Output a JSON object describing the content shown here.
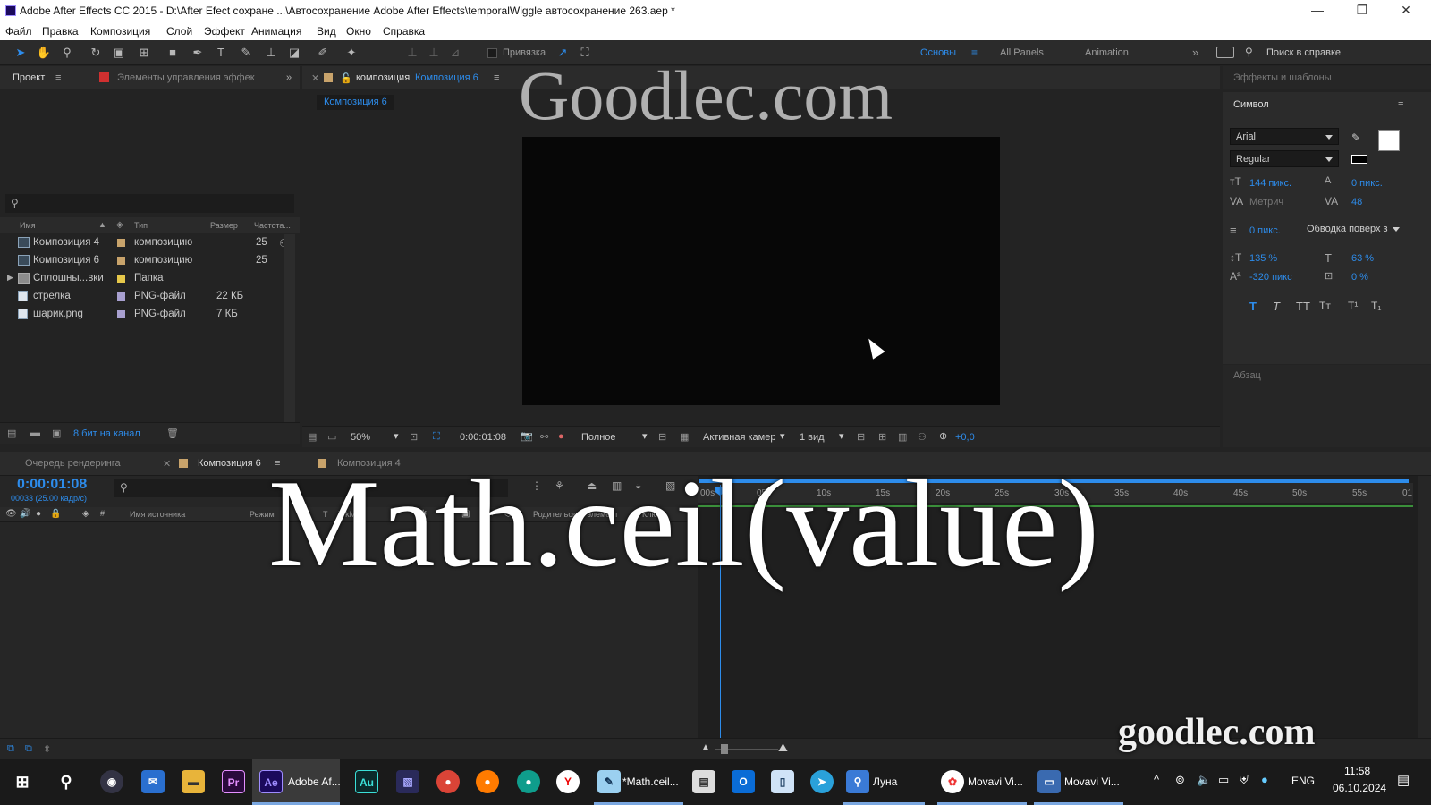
{
  "titlebar": {
    "title": "Adobe After Effects CC 2015 - D:\\After Efect сохране ...\\Автосохранение Adobe After Effects\\temporalWiggle автосохранение 263.aep *",
    "minimize": "—",
    "maximize": "❐",
    "close": "✕"
  },
  "menu": [
    "Файл",
    "Правка",
    "Композиция",
    "Слой",
    "Эффект",
    "Анимация",
    "Вид",
    "Окно",
    "Справка"
  ],
  "toolbar": {
    "snap_label": "Привязка",
    "workspaces": [
      "Основы",
      "All Panels",
      "Animation"
    ],
    "search_placeholder": "Поиск в справке"
  },
  "project": {
    "tab_project": "Проект",
    "tab_effects": "Элементы управления эффек",
    "columns": [
      "Имя",
      "Тип",
      "Размер",
      "Частота..."
    ],
    "items": [
      {
        "name": "Композиция 4",
        "type": "композицию",
        "size": "",
        "rate": "25",
        "color": "#c8a36b"
      },
      {
        "name": "Композиция 6",
        "type": "композицию",
        "size": "",
        "rate": "25",
        "color": "#c8a36b"
      },
      {
        "name": "Сплошны...вки",
        "type": "Папка",
        "size": "",
        "rate": "",
        "color": "#e6c84a"
      },
      {
        "name": "стрелка",
        "type": "PNG-файл",
        "size": "22 КБ",
        "rate": "",
        "color": "#a8a0d0"
      },
      {
        "name": "шарик.png",
        "type": "PNG-файл",
        "size": "7 КБ",
        "rate": "",
        "color": "#a8a0d0"
      }
    ],
    "bit_depth": "8 бит на канал"
  },
  "viewer": {
    "tab_prefix": "композиция",
    "tab_name": "Композиция 6",
    "breadcrumb": "Композиция 6",
    "zoom": "50%",
    "timecode": "0:00:01:08",
    "resolution": "Полное",
    "camera": "Активная камер",
    "views": "1 вид",
    "exposure": "+0,0"
  },
  "right": {
    "effects_title": "Эффекты и шаблоны",
    "char_title": "Символ",
    "font": "Arial",
    "style": "Regular",
    "font_size": "144 пикс.",
    "leading": "0 пикс.",
    "kerning": "Метрич",
    "tracking": "48",
    "stroke_width": "0 пикс.",
    "stroke_mode": "Обводка поверх з",
    "vscale": "135 %",
    "hscale": "63 %",
    "baseline": "-320 пикс",
    "tsume": "0 %",
    "para_title": "Абзац"
  },
  "timeline": {
    "tab_render": "Очередь рендеринга",
    "tab_comp6": "Композиция 6",
    "tab_comp4": "Композиция 4",
    "timecode": "0:00:01:08",
    "fps": "00033 (25.00 кадр/с)",
    "cols": {
      "source": "Имя источника",
      "mode": "Режим",
      "t": "T",
      "trkmat": "TrkMat",
      "parent": "Родительский элемент",
      "keys": "Ключи"
    },
    "ruler": [
      "00s",
      "05s",
      "10s",
      "15s",
      "20s",
      "25s",
      "30s",
      "35s",
      "40s",
      "45s",
      "50s",
      "55s",
      "01"
    ]
  },
  "overlay": {
    "watermark": "Goodlec.com",
    "big_text": "Math.ceil(value)",
    "corner_brand": "goodlec.com"
  },
  "taskbar": {
    "apps": [
      "Adobe Af...",
      "*Math.ceil...",
      "Луна",
      "Movavi Vi...",
      "Movavi Vi..."
    ],
    "lang": "ENG",
    "time": "11:58",
    "date": "06.10.2024"
  }
}
